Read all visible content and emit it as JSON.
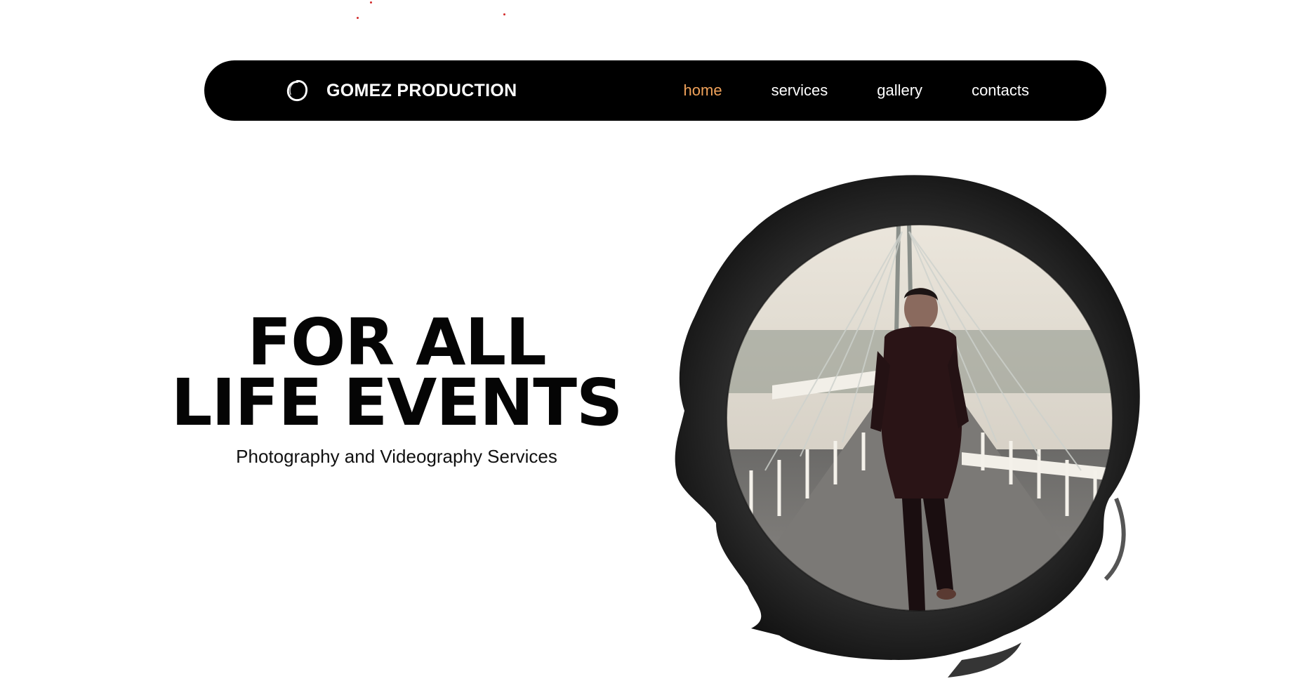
{
  "header": {
    "brand_name": "GOMEZ PRODUCTION",
    "logo_icon": "brush-circle-icon",
    "nav": [
      {
        "label": "home",
        "active": true
      },
      {
        "label": "services",
        "active": false
      },
      {
        "label": "gallery",
        "active": false
      },
      {
        "label": "contacts",
        "active": false
      }
    ]
  },
  "hero": {
    "title_line_1": "FOR ALL",
    "title_line_2": "LIFE EVENTS",
    "subtitle": "Photography and Videography Services",
    "image_alt": "Man in black coat walking on a bridge"
  },
  "colors": {
    "navbar_bg": "#000000",
    "nav_active": "#f0a25a",
    "nav_text": "#ffffff",
    "title_text": "#050505",
    "ink_stroke": "#1b1b1b"
  }
}
